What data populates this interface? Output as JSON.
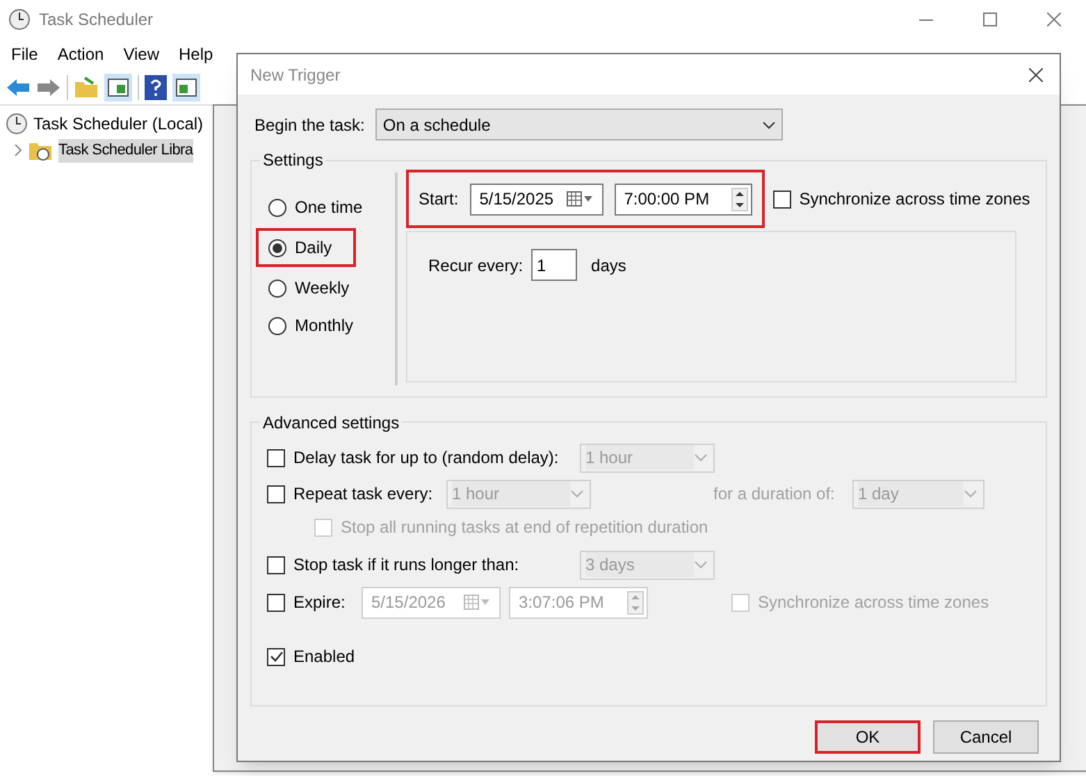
{
  "window": {
    "title": "Task Scheduler"
  },
  "menu": [
    "File",
    "Action",
    "View",
    "Help"
  ],
  "tree": [
    {
      "label": "Task Scheduler (Local)",
      "children": [
        {
          "label": "Task Scheduler Libra",
          "selected": true
        }
      ]
    }
  ],
  "dialog": {
    "title": "New Trigger",
    "begin_task": {
      "label": "Begin the task:",
      "value": "On a schedule"
    },
    "settings": {
      "title": "Settings",
      "options": [
        {
          "label": "One time",
          "selected": false,
          "highlighted": false
        },
        {
          "label": "Daily",
          "selected": true,
          "highlighted": true
        },
        {
          "label": "Weekly",
          "selected": false,
          "highlighted": false
        },
        {
          "label": "Monthly",
          "selected": false,
          "highlighted": false
        }
      ],
      "start": {
        "label": "Start:",
        "date": "5/15/2025",
        "time": "7:00:00 PM",
        "highlighted": true
      },
      "sync": {
        "label": "Synchronize across time zones",
        "checked": false,
        "disabled": false
      },
      "recur": {
        "label": "Recur every:",
        "value": "1",
        "unit": "days"
      }
    },
    "advanced": {
      "title": "Advanced settings",
      "delay": {
        "label": "Delay task for up to (random delay):",
        "checked": false,
        "value": "1 hour",
        "disabled": true
      },
      "repeat": {
        "label": "Repeat task every:",
        "checked": false,
        "value": "1 hour",
        "disabled": true,
        "duration_label": "for a duration of:",
        "duration_value": "1 day"
      },
      "stop_all": {
        "label": "Stop all running tasks at end of repetition duration",
        "checked": false,
        "disabled": true
      },
      "stop_task": {
        "label": "Stop task if it runs longer than:",
        "checked": false,
        "value": "3 days",
        "disabled": true
      },
      "expire": {
        "label": "Expire:",
        "checked": false,
        "date": "5/15/2026",
        "time": "3:07:06 PM",
        "disabled": true,
        "sync_label": "Synchronize across time zones",
        "sync_checked": false
      },
      "enabled": {
        "label": "Enabled",
        "checked": true
      }
    },
    "buttons": [
      {
        "label": "OK",
        "highlighted": true
      },
      {
        "label": "Cancel",
        "highlighted": false
      }
    ]
  }
}
